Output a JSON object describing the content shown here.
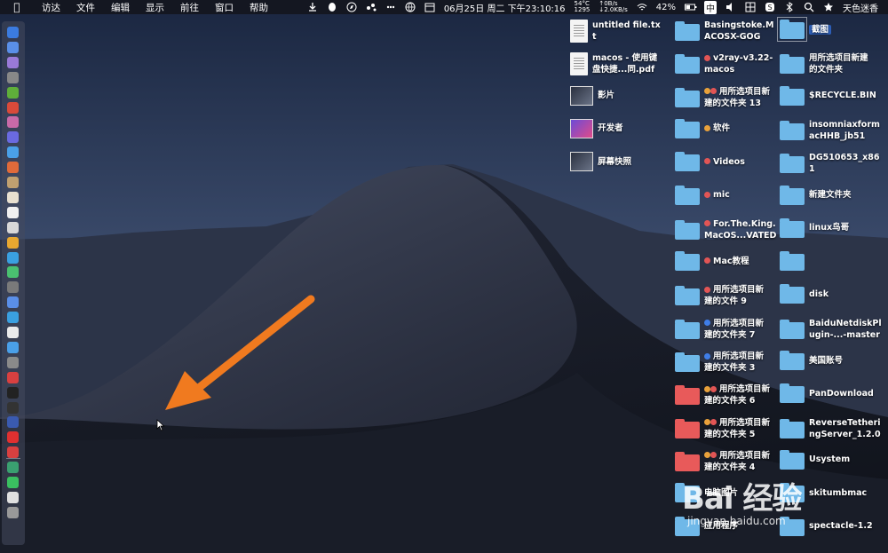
{
  "menubar": {
    "apple": "",
    "items": [
      "访达",
      "文件",
      "编辑",
      "显示",
      "前往",
      "窗口",
      "帮助"
    ],
    "status": {
      "cpu_temp": "54°C",
      "fan": "1295",
      "net_up": "↑0B/s",
      "net_down": "↓2.0KB/s",
      "datetime": "06月25日 周二 下午23:10:16",
      "battery": "42%",
      "input_method": "中",
      "user": "天色迷香"
    }
  },
  "desktop": {
    "left_column": [
      {
        "name": "untitled file.txt",
        "kind": "doc"
      },
      {
        "name": "macos - 使用键\n盘快捷...同.pdf",
        "kind": "pdf"
      },
      {
        "name": "影片",
        "kind": "image"
      },
      {
        "name": "开发者",
        "kind": "app"
      },
      {
        "name": "屏幕快照",
        "kind": "screenshot"
      }
    ],
    "mid_column": [
      {
        "name": "Basingstoke.M\nACOSX-GOG",
        "tags": []
      },
      {
        "name": "v2ray-v3.22-\nmacos",
        "tags": [
          "#e25555"
        ]
      },
      {
        "name": "用所选项目新\n建的文件夹 13",
        "tags": [
          "#e8a13b",
          "#e25555"
        ]
      },
      {
        "name": "软件",
        "tags": [
          "#e8a13b"
        ]
      },
      {
        "name": "Videos",
        "tags": [
          "#e25555"
        ]
      },
      {
        "name": "mic",
        "tags": [
          "#e25555"
        ]
      },
      {
        "name": "For.The.King.\nMacOS...VATED",
        "tags": [
          "#e25555"
        ]
      },
      {
        "name": "Mac教程",
        "tags": [
          "#e25555"
        ]
      },
      {
        "name": "用所选项目新\n建的文件 9",
        "tags": [
          "#e25555"
        ]
      },
      {
        "name": "用所选项目新\n建的文件夹 7",
        "tags": [
          "#3f7ee8"
        ]
      },
      {
        "name": "用所选项目新\n建的文件夹 3",
        "tags": [
          "#3f7ee8"
        ]
      },
      {
        "name": "用所选项目新\n建的文件夹 6",
        "tags": [
          "#e8a13b",
          "#e25555"
        ]
      },
      {
        "name": "用所选项目新\n建的文件夹 5",
        "tags": [
          "#e8a13b",
          "#e25555"
        ]
      },
      {
        "name": "用所选项目新\n建的文件夹 4",
        "tags": [
          "#e8a13b",
          "#e25555"
        ]
      },
      {
        "name": "电脑图片",
        "tags": []
      },
      {
        "name": "应用程序",
        "tags": []
      }
    ],
    "right_column": [
      {
        "name": "截图",
        "selected": true
      },
      {
        "name": "用所选项目新建\n的文件夹"
      },
      {
        "name": "$RECYCLE.BIN"
      },
      {
        "name": "insomniaxform\nacHHB_jb51"
      },
      {
        "name": "DG510653_x86\n1"
      },
      {
        "name": "新建文件夹"
      },
      {
        "name": "linux鸟哥"
      },
      {
        "name": ""
      },
      {
        "name": "disk"
      },
      {
        "name": "BaiduNetdiskPl\nugin-...-master"
      },
      {
        "name": "美国账号"
      },
      {
        "name": "PanDownload"
      },
      {
        "name": "ReverseTetheri\nngServer_1.2.0"
      },
      {
        "name": "Usystem"
      },
      {
        "name": "skitumbmac"
      },
      {
        "name": "spectacle-1.2"
      }
    ]
  },
  "watermark": {
    "logo": "Bai 经验",
    "url": "jingyan.baidu.com"
  },
  "colors": {
    "accent": "#2d5fb8",
    "arrow": "#f07a1f",
    "folder": "#6fb8e8",
    "folder_red": "#e85a5a"
  }
}
